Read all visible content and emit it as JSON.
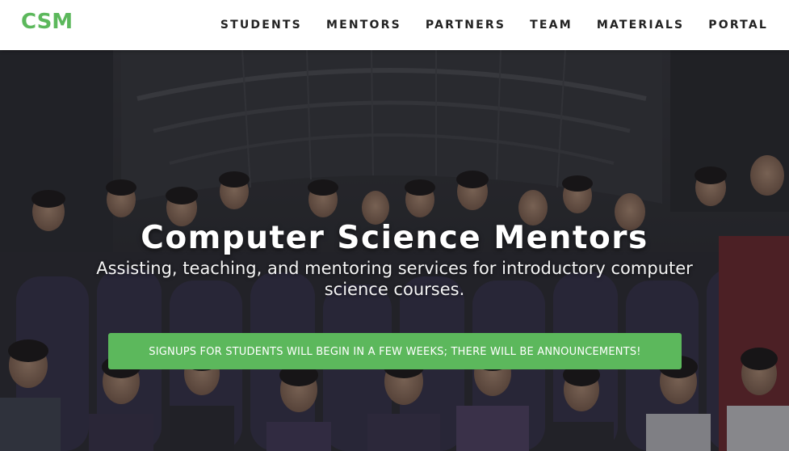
{
  "brand": {
    "name": "CSM",
    "color": "#5cb85c"
  },
  "nav": {
    "items": [
      {
        "label": "STUDENTS"
      },
      {
        "label": "MENTORS"
      },
      {
        "label": "PARTNERS"
      },
      {
        "label": "TEAM"
      },
      {
        "label": "MATERIALS"
      },
      {
        "label": "PORTAL"
      }
    ]
  },
  "hero": {
    "title": "Computer Science Mentors",
    "subtitle": "Assisting, teaching, and mentoring services for introductory computer science courses.",
    "button_label": "SIGNUPS FOR STUDENTS WILL BEGIN IN A FEW WEEKS; THERE WILL BE ANNOUNCEMENTS!",
    "button_color": "#5cb85c",
    "background_image": "group-photo"
  }
}
